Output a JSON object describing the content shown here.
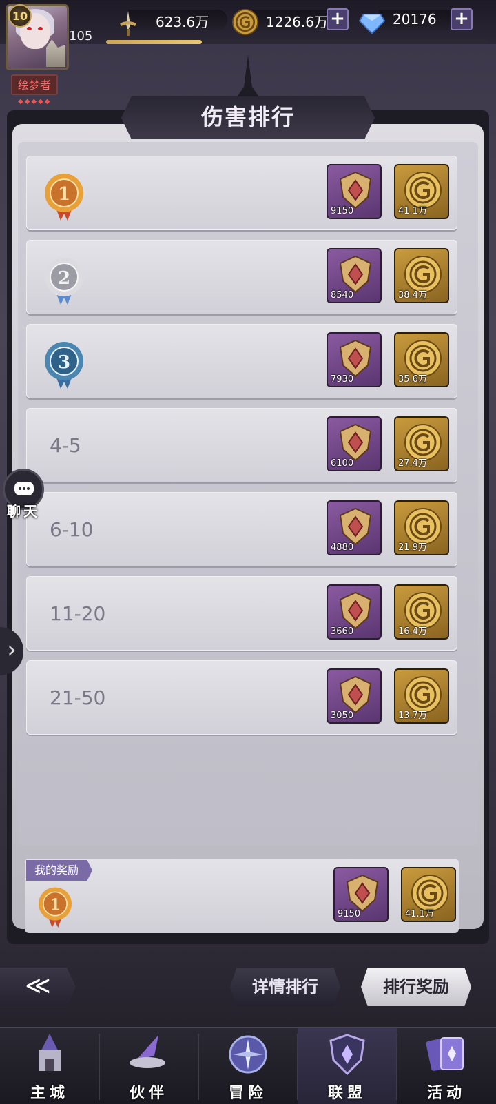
{
  "header": {
    "level": "10",
    "power_small": "105",
    "exp_progress": 0.25,
    "title_tag": "绘梦者",
    "title_tag_gems": "◆◆◆◆◆"
  },
  "resources": {
    "combat_power": "623.6万",
    "gold": "1226.6万",
    "diamonds": "20176",
    "plus": "+"
  },
  "panel": {
    "title": "伤害排行"
  },
  "ranks": [
    {
      "rank": "1",
      "label": "",
      "medal": "gold-medal",
      "badge_qty": "9150",
      "gold_qty": "41.1万"
    },
    {
      "rank": "2",
      "label": "",
      "medal": "silver-medal",
      "badge_qty": "8540",
      "gold_qty": "38.4万"
    },
    {
      "rank": "3",
      "label": "",
      "medal": "blue-medal",
      "badge_qty": "7930",
      "gold_qty": "35.6万"
    },
    {
      "rank": "",
      "label": "4-5",
      "medal": "",
      "badge_qty": "6100",
      "gold_qty": "27.4万"
    },
    {
      "rank": "",
      "label": "6-10",
      "medal": "",
      "badge_qty": "4880",
      "gold_qty": "21.9万"
    },
    {
      "rank": "",
      "label": "11-20",
      "medal": "",
      "badge_qty": "3660",
      "gold_qty": "16.4万"
    },
    {
      "rank": "",
      "label": "21-50",
      "medal": "",
      "badge_qty": "3050",
      "gold_qty": "13.7万"
    }
  ],
  "my_reward": {
    "tag": "我的奖励",
    "rank": "1",
    "badge_qty": "9150",
    "gold_qty": "41.1万"
  },
  "chat": {
    "label": "聊天"
  },
  "side_arrow": "›",
  "buttons": {
    "back": "≪",
    "detail_ranking": "详情排行",
    "ranking_rewards": "排行奖励"
  },
  "nav": [
    {
      "label": "主城",
      "icon": "castle-icon",
      "active": false
    },
    {
      "label": "伙伴",
      "icon": "witch-hat-icon",
      "active": false
    },
    {
      "label": "冒险",
      "icon": "compass-icon",
      "active": false
    },
    {
      "label": "联盟",
      "icon": "shield-icon",
      "active": true
    },
    {
      "label": "活动",
      "icon": "cards-icon",
      "active": false
    }
  ],
  "colors": {
    "accent_gold": "#c9a45c",
    "panel_light": "#dedde2",
    "badge_purple": "#8a5aa0",
    "tag_purple": "#7a6aa6"
  }
}
